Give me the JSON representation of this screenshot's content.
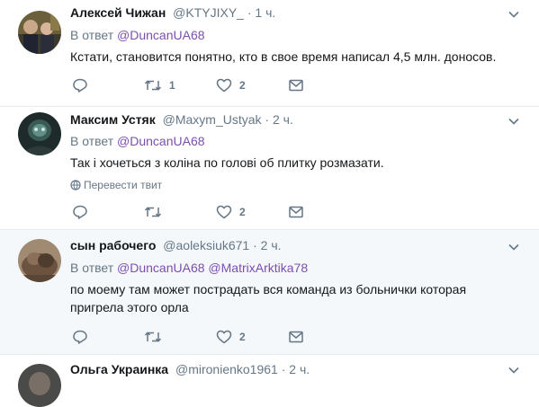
{
  "tweets": [
    {
      "name": "Алексей Чижан",
      "handle": "@KTYJIXY_",
      "dot": "·",
      "time": "1 ч.",
      "reply_prefix": "В ответ",
      "mentions": [
        "@DuncanUA68"
      ],
      "text": "Кстати, становится понятно, кто в свое время написал 4,5 млн. доносов.",
      "retweets": "1",
      "likes": "2"
    },
    {
      "name": "Максим Устяк",
      "handle": "@Maxym_Ustyak",
      "dot": "·",
      "time": "2 ч.",
      "reply_prefix": "В ответ",
      "mentions": [
        "@DuncanUA68"
      ],
      "text": "Так і хочеться з коліна по голові об плитку розмазати.",
      "translate": "Перевести твит",
      "retweets": "",
      "likes": "2"
    },
    {
      "name": "сын рабочего",
      "handle": "@aoleksiuk671",
      "dot": "·",
      "time": "2 ч.",
      "reply_prefix": "В ответ",
      "mentions": [
        "@DuncanUA68",
        "@MatrixArktika78"
      ],
      "text": "по моему там может пострадать вся команда из больнички которая пригрела этого орла",
      "retweets": "",
      "likes": "2"
    },
    {
      "name": "Ольга Украинка",
      "handle": "@mironienko1961",
      "dot": "·",
      "time": "2 ч."
    }
  ],
  "icons": {
    "reply": "reply-icon",
    "retweet": "retweet-icon",
    "like": "heart-icon",
    "message": "envelope-icon",
    "more": "chevron-down-icon",
    "translate": "globe-icon"
  },
  "colors": {
    "mention": "#7b4fb0",
    "muted": "#657786",
    "text": "#14171a",
    "highlight_bg": "#f5f8fa"
  }
}
